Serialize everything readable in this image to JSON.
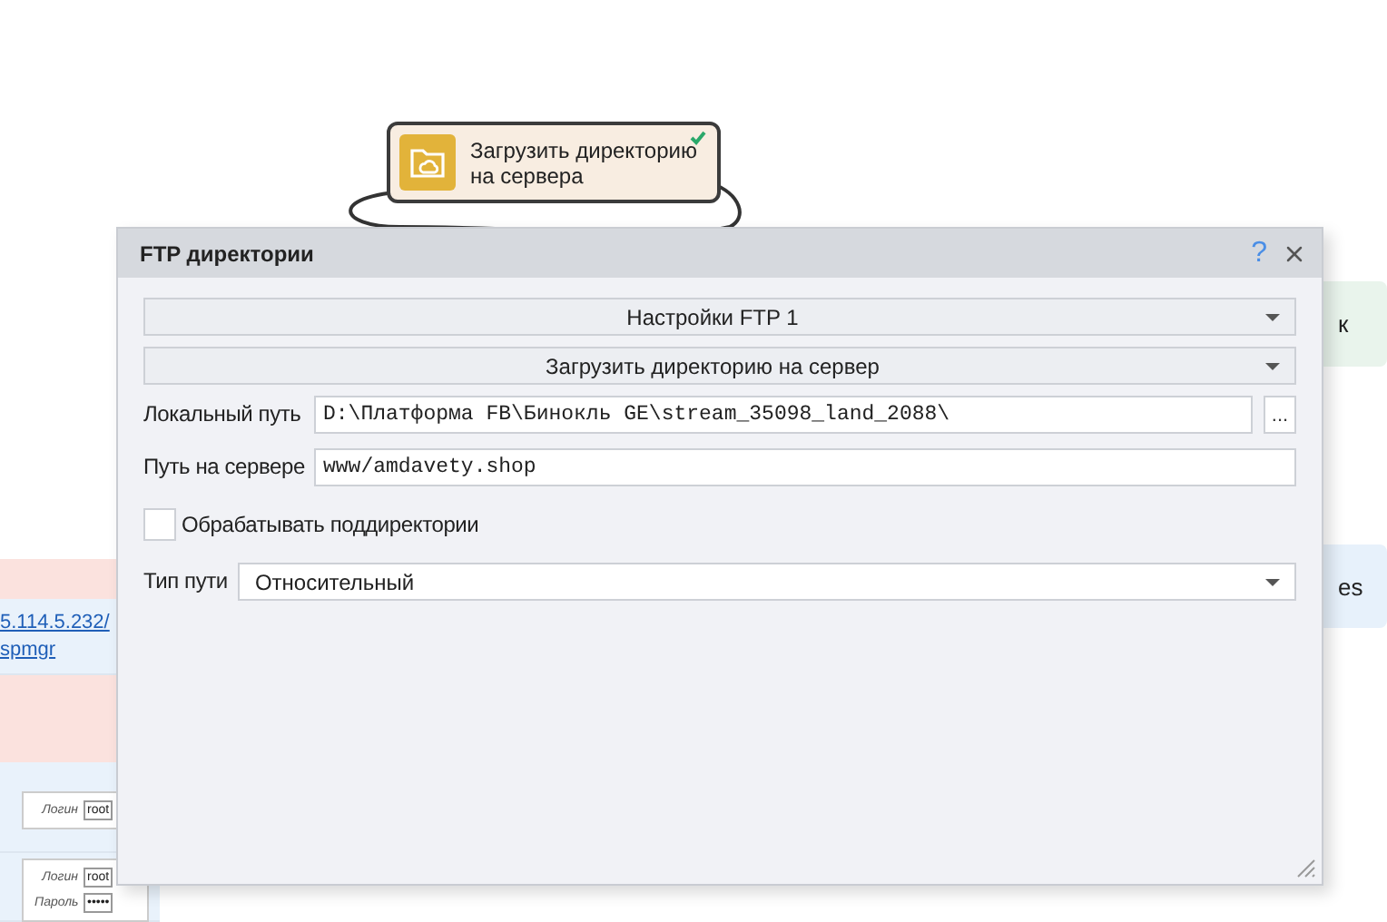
{
  "canvas": {
    "node": {
      "title": "Загрузить директорию на сервера",
      "done": true
    },
    "left_panel": {
      "link_lines": [
        "5.114.5.232/",
        "spmgr"
      ],
      "form_cards": [
        {
          "fields": [
            {
              "label": "Логин",
              "value": "root"
            }
          ]
        },
        {
          "fields": [
            {
              "label": "Логин",
              "value": "root"
            },
            {
              "label": "Пароль",
              "value": "•••••"
            }
          ]
        }
      ]
    },
    "right_panels": [
      {
        "text": "к",
        "color": "#e9f4ec"
      },
      {
        "text": "es",
        "color": "#e7f1fb"
      }
    ]
  },
  "dialog": {
    "title": "FTP директории",
    "help": "?",
    "dropdowns": [
      {
        "value": "Настройки FTP 1"
      },
      {
        "value": "Загрузить директорию на сервер"
      }
    ],
    "local_path": {
      "label": "Локальный путь",
      "value": "D:\\Платформа FB\\Бинокль GE\\stream_35098_land_2088\\",
      "browse": "..."
    },
    "server_path": {
      "label": "Путь на сервере",
      "value": "www/amdavety.shop"
    },
    "subdirs": {
      "label": "Обрабатывать поддиректории",
      "checked": false
    },
    "path_type": {
      "label": "Тип пути",
      "value": "Относительный"
    }
  }
}
